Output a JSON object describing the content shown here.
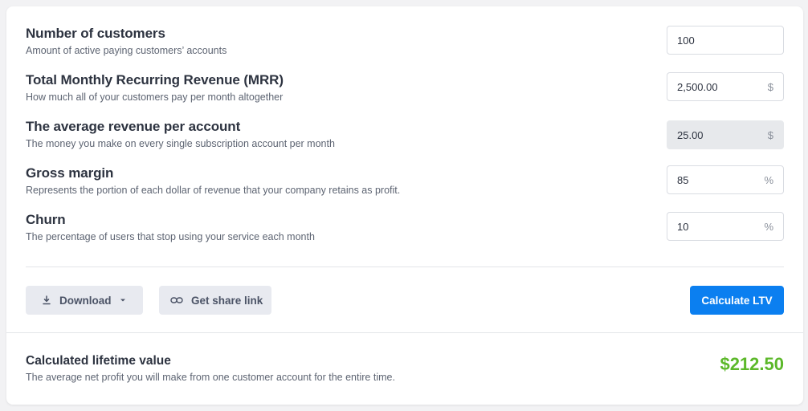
{
  "fields": [
    {
      "label": "Number of customers",
      "desc": "Amount of active paying customers’ accounts",
      "value": "100",
      "unit": ""
    },
    {
      "label": "Total Monthly Recurring Revenue (MRR)",
      "desc": "How much all of your customers pay per month altogether",
      "value": "2,500.00",
      "unit": "$"
    },
    {
      "label": "The average revenue per account",
      "desc": "The money you make on every single subscription account per month",
      "value": "25.00",
      "unit": "$"
    },
    {
      "label": "Gross margin",
      "desc": "Represents the portion of each dollar of revenue that your company retains as profit.",
      "value": "85",
      "unit": "%"
    },
    {
      "label": "Churn",
      "desc": "The percentage of users that stop using your service each month",
      "value": "10",
      "unit": "%"
    }
  ],
  "actions": {
    "download_label": "Download",
    "share_label": "Get share link",
    "calculate_label": "Calculate LTV"
  },
  "result": {
    "label": "Calculated lifetime value",
    "desc": "The average net profit you will make from one customer account for the entire time.",
    "value": "$212.50",
    "value_color": "#5cb82a"
  },
  "colors": {
    "primary": "#0b7ff0",
    "success": "#5cb82a"
  },
  "icons": {
    "download": "download-icon",
    "dropdown": "caret-down-icon",
    "share": "link-icon"
  }
}
